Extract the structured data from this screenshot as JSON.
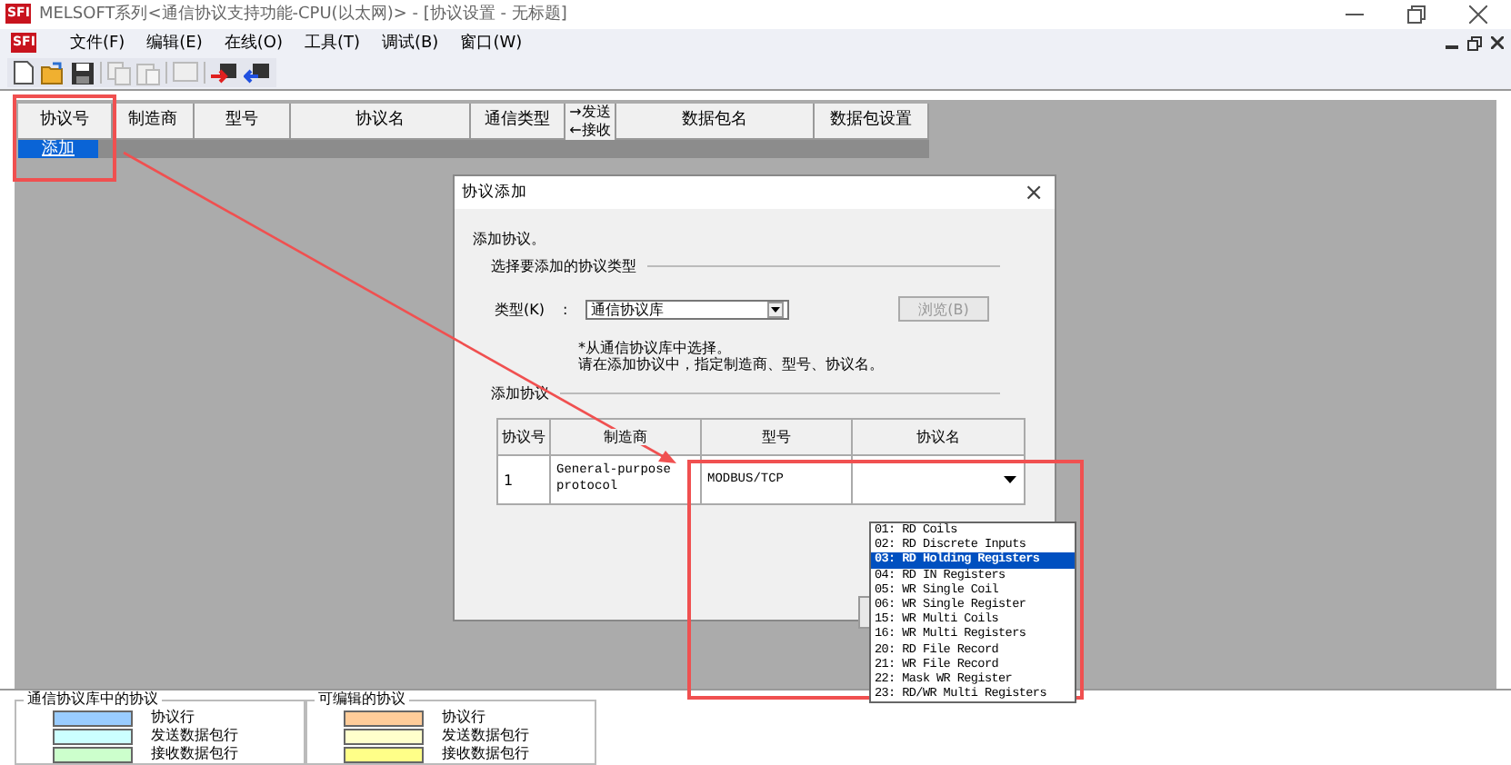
{
  "window": {
    "title": "MELSOFT系列<通信协议支持功能-CPU(以太网)> - [协议设置 - 无标题]",
    "logo": "SFI"
  },
  "menubar_logo": "SFI",
  "menu": [
    "文件(F)",
    "编辑(E)",
    "在线(O)",
    "工具(T)",
    "调试(B)",
    "窗口(W)"
  ],
  "table": {
    "columns": [
      "协议号",
      "制造商",
      "型号",
      "协议名",
      "通信类型",
      "→发送",
      "←接收",
      "数据包名",
      "数据包设置"
    ],
    "add_link": "添加"
  },
  "dialog": {
    "title": "协议添加",
    "close": "×",
    "intro": "添加协议。",
    "section1": "选择要添加的协议类型",
    "type_label": "类型(K)",
    "colon": ":",
    "type_value": "通信协议库",
    "browse": "浏览(B)",
    "hint1": "*从通信协议库中选择。",
    "hint2": "请在添加协议中，指定制造商、型号、协议名。",
    "section2": "添加协议",
    "columns": [
      "协议号",
      "制造商",
      "型号",
      "协议名"
    ],
    "row": {
      "number": "1",
      "maker": "General-purpose protocol",
      "model": "MODBUS/TCP"
    }
  },
  "dropdown": [
    {
      "label": "01: RD Coils",
      "selected": false
    },
    {
      "label": "02: RD Discrete Inputs",
      "selected": false
    },
    {
      "label": "03: RD Holding Registers",
      "selected": true
    },
    {
      "label": "04: RD IN Registers",
      "selected": false
    },
    {
      "label": "05: WR Single Coil",
      "selected": false
    },
    {
      "label": "06: WR Single Register",
      "selected": false
    },
    {
      "label": "15: WR Multi Coils",
      "selected": false
    },
    {
      "label": "16: WR Multi Registers",
      "selected": false
    },
    {
      "label": "20: RD File Record",
      "selected": false
    },
    {
      "label": "21: WR File Record",
      "selected": false
    },
    {
      "label": "22: Mask WR Register",
      "selected": false
    },
    {
      "label": "23: RD/WR Multi Registers",
      "selected": false
    }
  ],
  "legends": [
    {
      "title": "通信协议库中的协议",
      "items": [
        {
          "label": "协议行",
          "color": "#99ccff"
        },
        {
          "label": "发送数据包行",
          "color": "#ccffff"
        },
        {
          "label": "接收数据包行",
          "color": "#ccffcc"
        }
      ]
    },
    {
      "title": "可编辑的协议",
      "items": [
        {
          "label": "协议行",
          "color": "#ffcc99"
        },
        {
          "label": "发送数据包行",
          "color": "#ffffcc"
        },
        {
          "label": "接收数据包行",
          "color": "#ffff88"
        }
      ]
    }
  ]
}
